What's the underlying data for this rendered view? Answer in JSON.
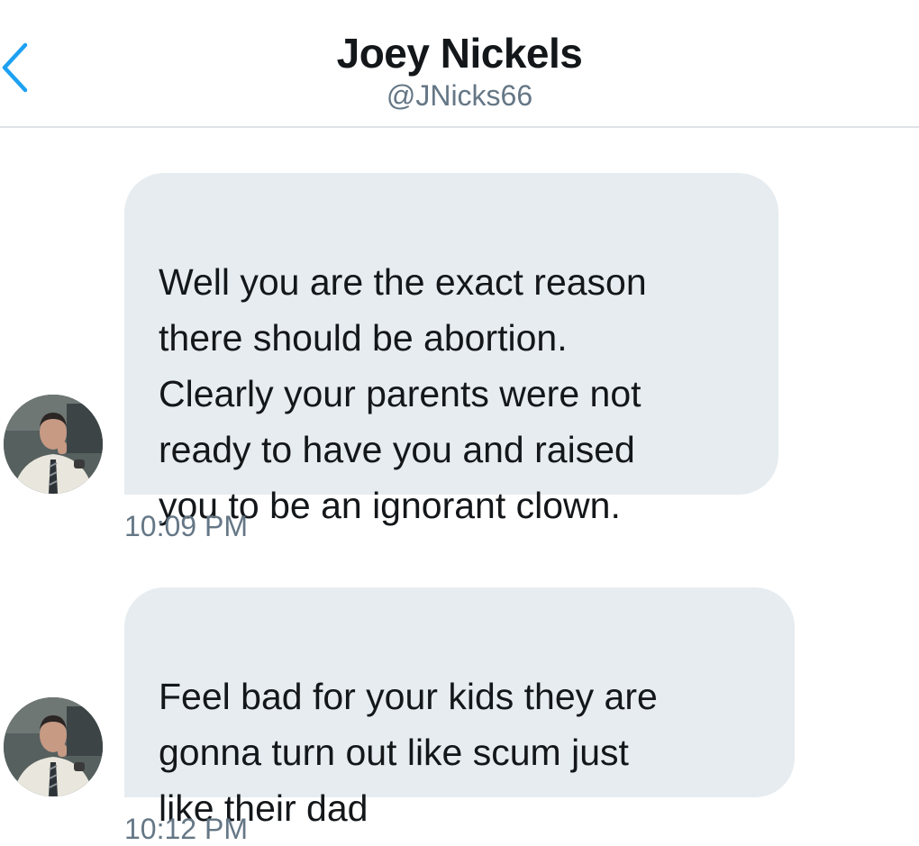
{
  "header": {
    "back_icon": "chevron-left-icon",
    "name": "Joey Nickels",
    "handle": "@JNicks66"
  },
  "colors": {
    "accent": "#1da1f2",
    "bubble": "#e6ecf0",
    "secondary_text": "#657786"
  },
  "messages": [
    {
      "text": "Well you are the exact reason\nthere should be abortion.\nClearly your parents were not\nready to have you and raised\nyou to be an ignorant clown.",
      "time": "10:09 PM"
    },
    {
      "text": "Feel bad for your kids they are\ngonna turn out like scum just\nlike their dad",
      "time": "10:12 PM"
    }
  ]
}
